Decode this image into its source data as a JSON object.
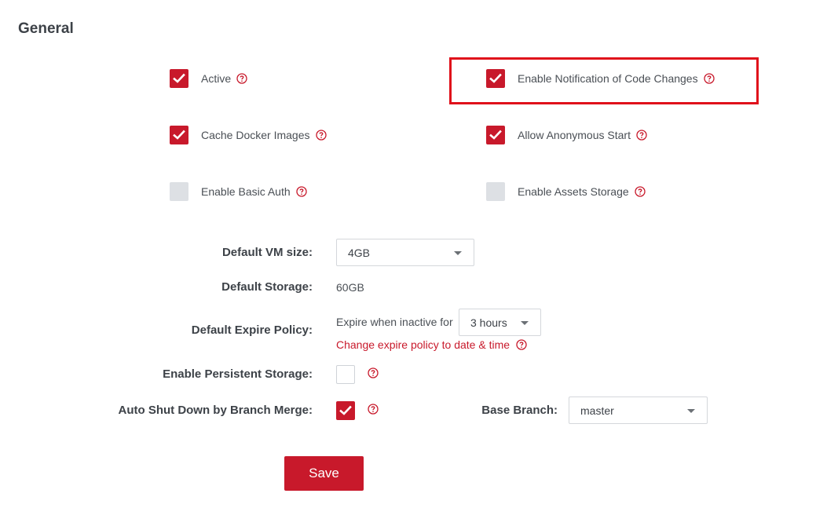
{
  "section": {
    "title": "General"
  },
  "options": {
    "active": {
      "label": "Active",
      "checked": true
    },
    "notify_code_changes": {
      "label": "Enable Notification of Code Changes",
      "checked": true
    },
    "cache_docker": {
      "label": "Cache Docker Images",
      "checked": true
    },
    "anonymous_start": {
      "label": "Allow Anonymous Start",
      "checked": true
    },
    "basic_auth": {
      "label": "Enable Basic Auth",
      "checked": false
    },
    "assets_storage": {
      "label": "Enable Assets Storage",
      "checked": false
    }
  },
  "form": {
    "vm_size": {
      "label": "Default VM size:",
      "value": "4GB"
    },
    "storage": {
      "label": "Default Storage:",
      "value": "60GB"
    },
    "expire": {
      "label": "Default Expire Policy:",
      "prefix": "Expire when inactive for",
      "value": "3 hours",
      "link": "Change expire policy to date & time"
    },
    "persistent": {
      "label": "Enable Persistent Storage:",
      "checked": false
    },
    "auto_shutdown": {
      "label": "Auto Shut Down by Branch Merge:",
      "checked": true
    },
    "base_branch": {
      "label": "Base Branch:",
      "value": "master"
    }
  },
  "actions": {
    "save_label": "Save"
  },
  "colors": {
    "accent": "#c8192b",
    "highlight": "#e0111b",
    "unchecked": "#dde0e4"
  },
  "icons": {
    "help": "question-circle-icon",
    "check": "checkmark-icon",
    "dropdown": "caret-down-icon"
  }
}
